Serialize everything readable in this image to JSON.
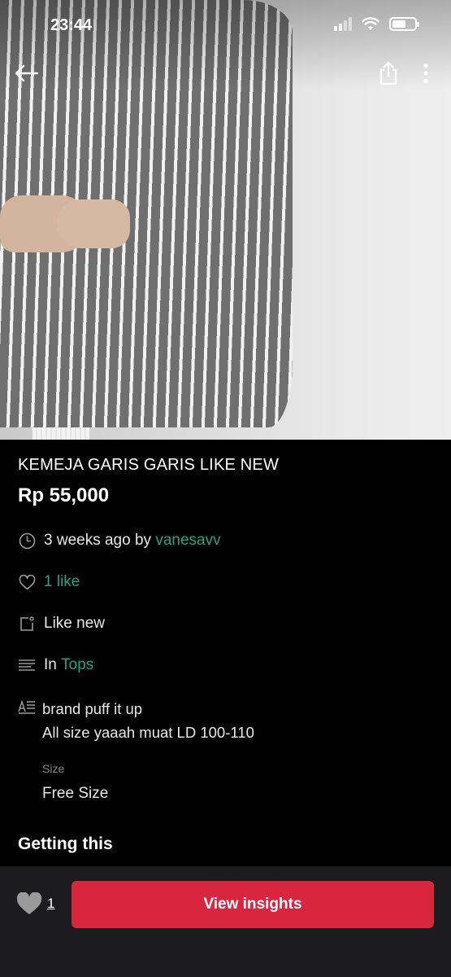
{
  "status_bar": {
    "time": "23:44"
  },
  "product": {
    "title": "KEMEJA GARIS GARIS LIKE NEW",
    "price": "Rp 55,000",
    "posted": {
      "prefix": "3 weeks ago by",
      "seller": "vanesavv"
    },
    "likes_text": "1 like",
    "condition": "Like new",
    "category": {
      "prefix": "In",
      "name": "Tops"
    },
    "description_lines": [
      "brand puff it up",
      "All size yaaah muat LD 100-110"
    ],
    "size": {
      "label": "Size",
      "value": "Free Size"
    }
  },
  "section_heading": "Getting this",
  "bottom_bar": {
    "like_count": "1",
    "cta_label": "View insights"
  },
  "icons": {
    "back": "arrow-left-icon",
    "share": "share-icon",
    "more": "more-vertical-icon",
    "clock": "clock-icon",
    "heart": "heart-icon",
    "condition": "tag-icon",
    "category": "list-icon",
    "description": "text-icon"
  },
  "colors": {
    "accent_green": "#1ea688",
    "cta_red": "#d7263d"
  }
}
